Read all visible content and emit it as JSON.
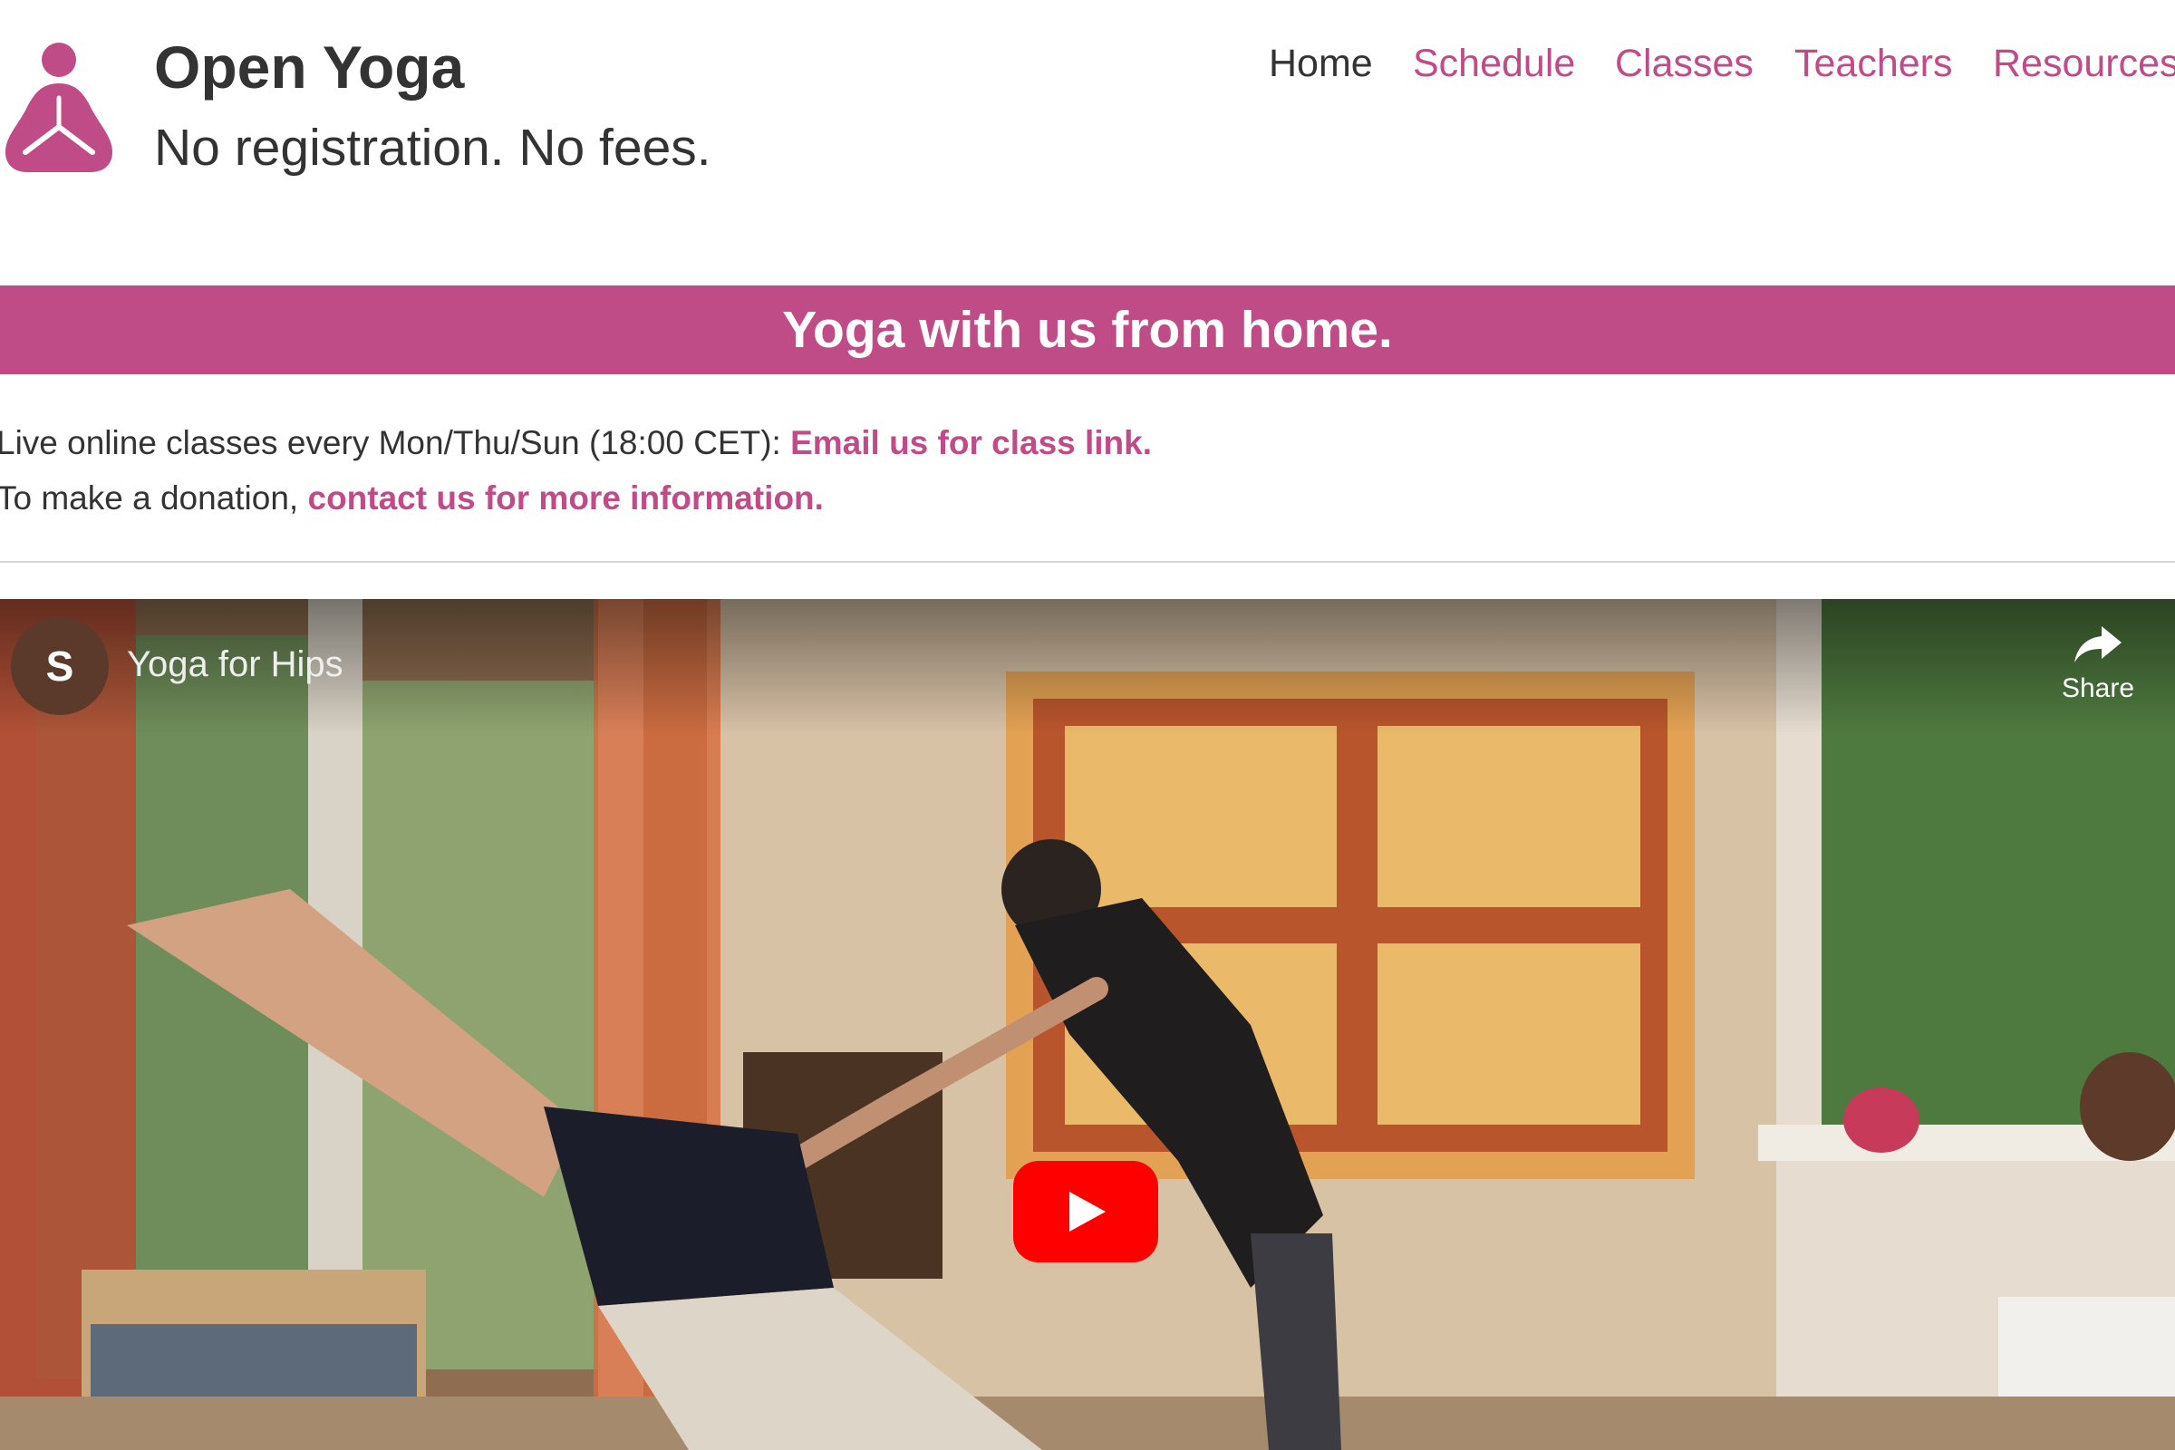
{
  "site": {
    "title": "Open Yoga",
    "tagline": "No registration. No fees.",
    "logo_icon": "meditation-person-icon"
  },
  "nav": {
    "items": [
      {
        "label": "Home",
        "current": true
      },
      {
        "label": "Schedule",
        "current": false
      },
      {
        "label": "Classes",
        "current": false
      },
      {
        "label": "Teachers",
        "current": false
      },
      {
        "label": "Resources",
        "current": false
      }
    ]
  },
  "banner": {
    "text": "Yoga with us from home."
  },
  "info": {
    "line1_text": "Live online classes every Mon/Thu/Sun (18:00 CET): ",
    "line1_link": "Email us for class link.",
    "line2_text": "To make a donation, ",
    "line2_link": "contact us for more information."
  },
  "video": {
    "channel_initial": "S",
    "title": "Yoga for Hips",
    "share_label": "Share",
    "share_icon": "share-arrow-icon",
    "play_icon": "youtube-play-icon"
  },
  "colors": {
    "accent": "#bf4c87",
    "link": "#c04b88",
    "text": "#333333",
    "play_button": "#ff0000"
  }
}
